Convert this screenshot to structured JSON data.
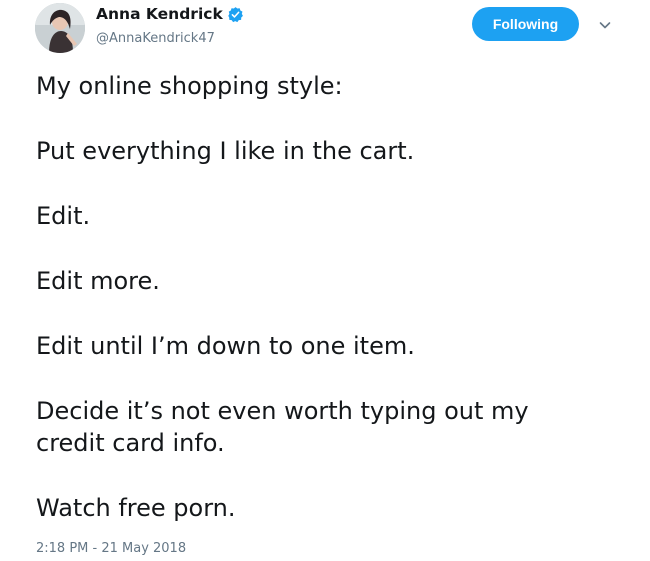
{
  "author": {
    "name": "Anna Kendrick",
    "handle": "@AnnaKendrick47",
    "verified_icon": "verified-badge-icon",
    "avatar_icon": "profile-photo"
  },
  "follow_button": {
    "label": "Following"
  },
  "menu": {
    "icon": "chevron-down-icon"
  },
  "tweet": {
    "lines": [
      "My online shopping style:",
      "Put everything I like in the cart.",
      "Edit.",
      "Edit more.",
      "Edit until I’m down to one item.",
      "Decide it’s not even worth typing out my",
      "credit card info.",
      "Watch free porn."
    ],
    "timestamp": "2:18 PM - 21 May 2018"
  },
  "colors": {
    "accent": "#1da1f2",
    "text": "#14171a",
    "secondary_text": "#657786"
  }
}
